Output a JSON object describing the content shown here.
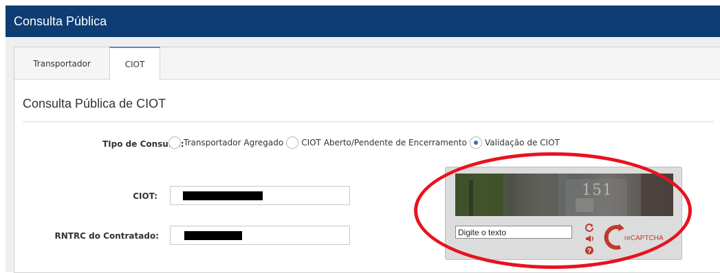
{
  "header": {
    "title": "Consulta Pública"
  },
  "tabs": [
    {
      "label": "Transportador",
      "active": false
    },
    {
      "label": "CIOT",
      "active": true
    }
  ],
  "section": {
    "title": "Consulta Pública de CIOT"
  },
  "tipo_consulta": {
    "label": "TIpo de Consulta:",
    "options": [
      {
        "label": "Transportador Agregado",
        "checked": false
      },
      {
        "label": "CIOT Aberto/Pendente de Encerramento",
        "checked": false
      },
      {
        "label": "Validação de CIOT",
        "checked": true
      }
    ]
  },
  "fields": {
    "ciot": {
      "label": "CIOT:",
      "value": ""
    },
    "rntrc": {
      "label": "RNTRC do Contratado:",
      "value": ""
    }
  },
  "captcha": {
    "image_text": "151",
    "input_value": "Digite o texto",
    "logo_text": "reCAPTCHA",
    "icons": [
      "refresh-icon",
      "audio-icon",
      "help-icon"
    ]
  },
  "colors": {
    "header_bg": "#0d3d73",
    "annotation_red": "#e8121e"
  }
}
